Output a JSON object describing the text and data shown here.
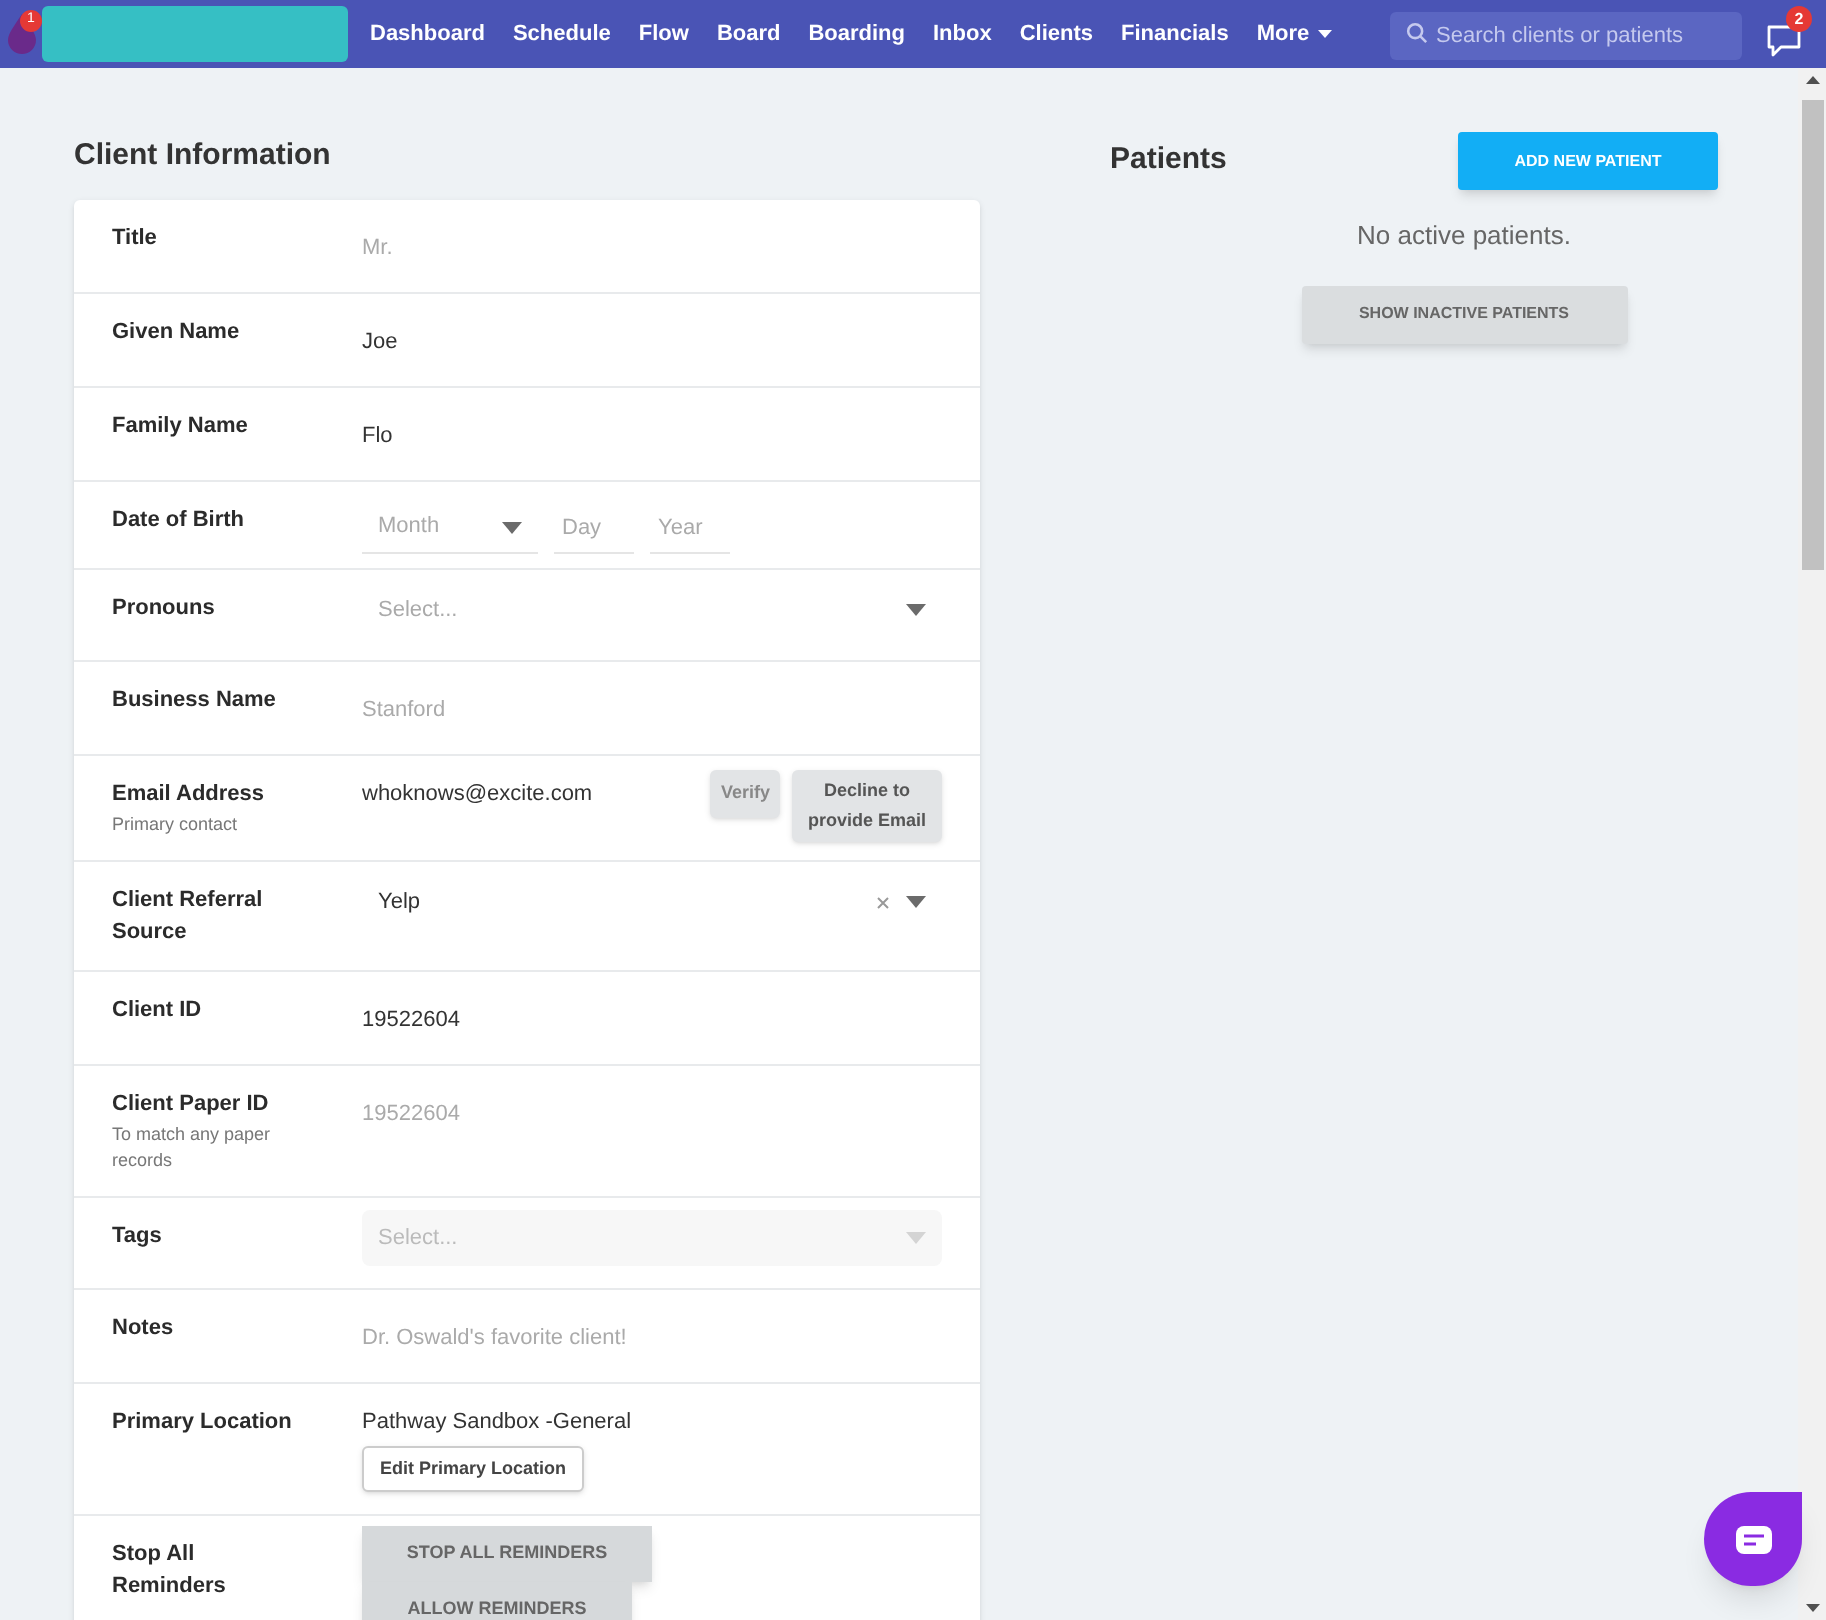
{
  "nav": {
    "logo_badge": "1",
    "links": [
      {
        "label": "Dashboard",
        "dropdown": false
      },
      {
        "label": "Schedule",
        "dropdown": false
      },
      {
        "label": "Flow",
        "dropdown": false
      },
      {
        "label": "Board",
        "dropdown": false
      },
      {
        "label": "Boarding",
        "dropdown": false
      },
      {
        "label": "Inbox",
        "dropdown": false
      },
      {
        "label": "Clients",
        "dropdown": false
      },
      {
        "label": "Financials",
        "dropdown": false
      },
      {
        "label": "More",
        "dropdown": true
      }
    ],
    "search": {
      "placeholder": "Search clients or patients"
    },
    "messages_badge": "2"
  },
  "client_info": {
    "title": "Client Information",
    "rows": [
      {
        "kind": "text",
        "label": "Title",
        "placeholder": "Mr."
      },
      {
        "kind": "text",
        "label": "Given Name",
        "value": "Joe"
      },
      {
        "kind": "text",
        "label": "Family Name",
        "value": "Flo"
      },
      {
        "kind": "date",
        "label": "Date of Birth",
        "month": {
          "placeholder": "Month"
        },
        "day": {
          "placeholder": "Day"
        },
        "year": {
          "placeholder": "Year"
        }
      },
      {
        "kind": "select",
        "label": "Pronouns",
        "placeholder": "Select...",
        "clearable": false,
        "disabled": false
      },
      {
        "kind": "text",
        "label": "Business Name",
        "placeholder": "Stanford"
      },
      {
        "kind": "email",
        "label": "Email Address",
        "hint": "Primary contact",
        "value": "whoknows@excite.com",
        "buttons": [
          "Verify",
          "Decline to provide Email"
        ]
      },
      {
        "kind": "select",
        "label": "Client Referral Source",
        "value": "Yelp",
        "clearable": true,
        "disabled": false
      },
      {
        "kind": "text",
        "label": "Client ID",
        "value": "19522604"
      },
      {
        "kind": "text",
        "label": "Client Paper ID",
        "hint": "To match any paper records",
        "placeholder": "19522604"
      },
      {
        "kind": "select",
        "label": "Tags",
        "placeholder": "Select...",
        "clearable": false,
        "disabled": true
      },
      {
        "kind": "text",
        "label": "Notes",
        "placeholder": "Dr. Oswald's favorite client!"
      },
      {
        "kind": "location",
        "label": "Primary Location",
        "value": "Pathway Sandbox -General",
        "button": "Edit Primary Location"
      },
      {
        "kind": "buttons",
        "label": "Stop All Reminders",
        "buttons": [
          "STOP ALL REMINDERS",
          "ALLOW REMINDERS"
        ]
      }
    ]
  },
  "patients": {
    "title": "Patients",
    "add_button": "ADD NEW PATIENT",
    "empty_text": "No active patients.",
    "show_inactive_button": "SHOW INACTIVE PATIENTS"
  }
}
